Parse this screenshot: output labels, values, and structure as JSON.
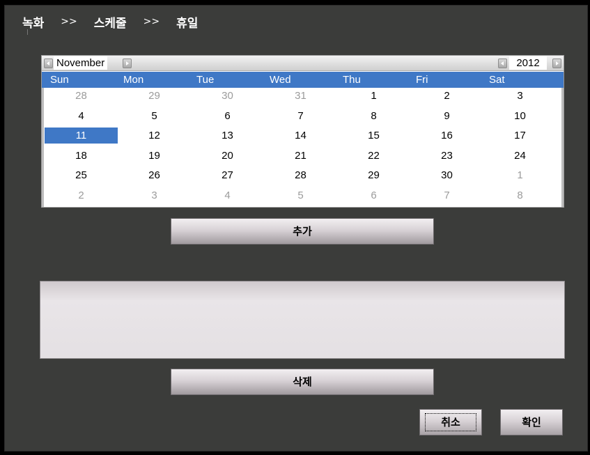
{
  "breadcrumb": {
    "items": [
      "녹화",
      "스케줄",
      "휴일"
    ],
    "separator": ">>"
  },
  "calendar": {
    "month": "November",
    "year": "2012",
    "weekdays": [
      "Sun",
      "Mon",
      "Tue",
      "Wed",
      "Thu",
      "Fri",
      "Sat"
    ],
    "weeks": [
      [
        "28",
        "29",
        "30",
        "31",
        "1",
        "2",
        "3"
      ],
      [
        "4",
        "5",
        "6",
        "7",
        "8",
        "9",
        "10"
      ],
      [
        "11",
        "12",
        "13",
        "14",
        "15",
        "16",
        "17"
      ],
      [
        "18",
        "19",
        "20",
        "21",
        "22",
        "23",
        "24"
      ],
      [
        "25",
        "26",
        "27",
        "28",
        "29",
        "30",
        "1"
      ],
      [
        "2",
        "3",
        "4",
        "5",
        "6",
        "7",
        "8"
      ]
    ],
    "selected_day": "11",
    "accent_color": "#3f78c6"
  },
  "buttons": {
    "add_label": "추가",
    "delete_label": "삭제",
    "cancel_label": "취소",
    "ok_label": "확인"
  },
  "holiday_list": []
}
